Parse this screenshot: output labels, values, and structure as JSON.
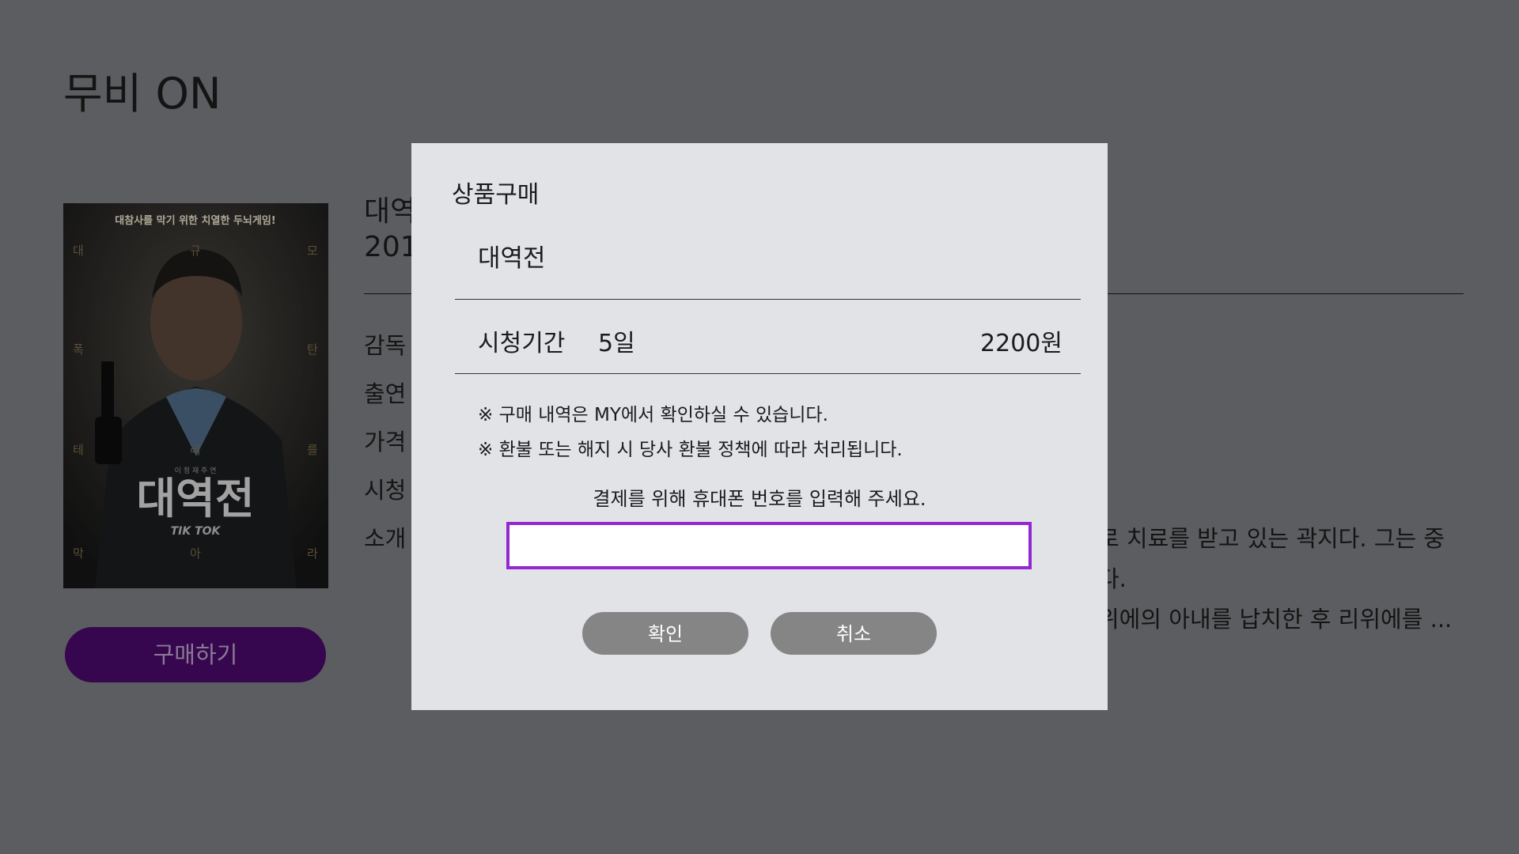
{
  "app": {
    "title": "무비 ON"
  },
  "poster": {
    "tagline": "대참사를 막기 위한 치열한 두뇌게임!",
    "title_art": "대역전",
    "logo_art": "TIK TOK",
    "cast_credit": "이 정 재 주 연",
    "side_chars_left": [
      "대",
      "폭",
      "테",
      "막"
    ],
    "side_chars_center": [
      "규",
      "러",
      "아"
    ],
    "side_chars_right": [
      "모",
      "탄",
      "를",
      "라"
    ]
  },
  "buy_button": {
    "label": "구매하기"
  },
  "detail": {
    "title": "대역",
    "year": "201",
    "labels": [
      "감독",
      "출연",
      "가격",
      "시청",
      "소개"
    ],
    "synopsis_lines": [
      "로 치료를 받고 있는 곽지다. 그는 중",
      "다.",
      "위에의 아내를 납치한 후 리위에를 ..."
    ]
  },
  "modal": {
    "title": "상품구매",
    "movie_title": "대역전",
    "period_label": "시청기간",
    "period_value": "5일",
    "price": "2200원",
    "notice_1": "※ 구매 내역은 MY에서 확인하실 수 있습니다.",
    "notice_2": "※ 환불 또는 해지 시 당사 환불 정책에 따라 처리됩니다.",
    "phone_prompt": "결제를 위해 휴대폰 번호를 입력해 주세요.",
    "phone_value": "",
    "confirm_label": "확인",
    "cancel_label": "취소"
  },
  "colors": {
    "background_dim": "#5c5d60",
    "modal_bg": "#e1e3e7",
    "input_focus_border": "#9327d2",
    "buy_button_bg": "#36074f",
    "modal_button_bg": "#858585"
  }
}
